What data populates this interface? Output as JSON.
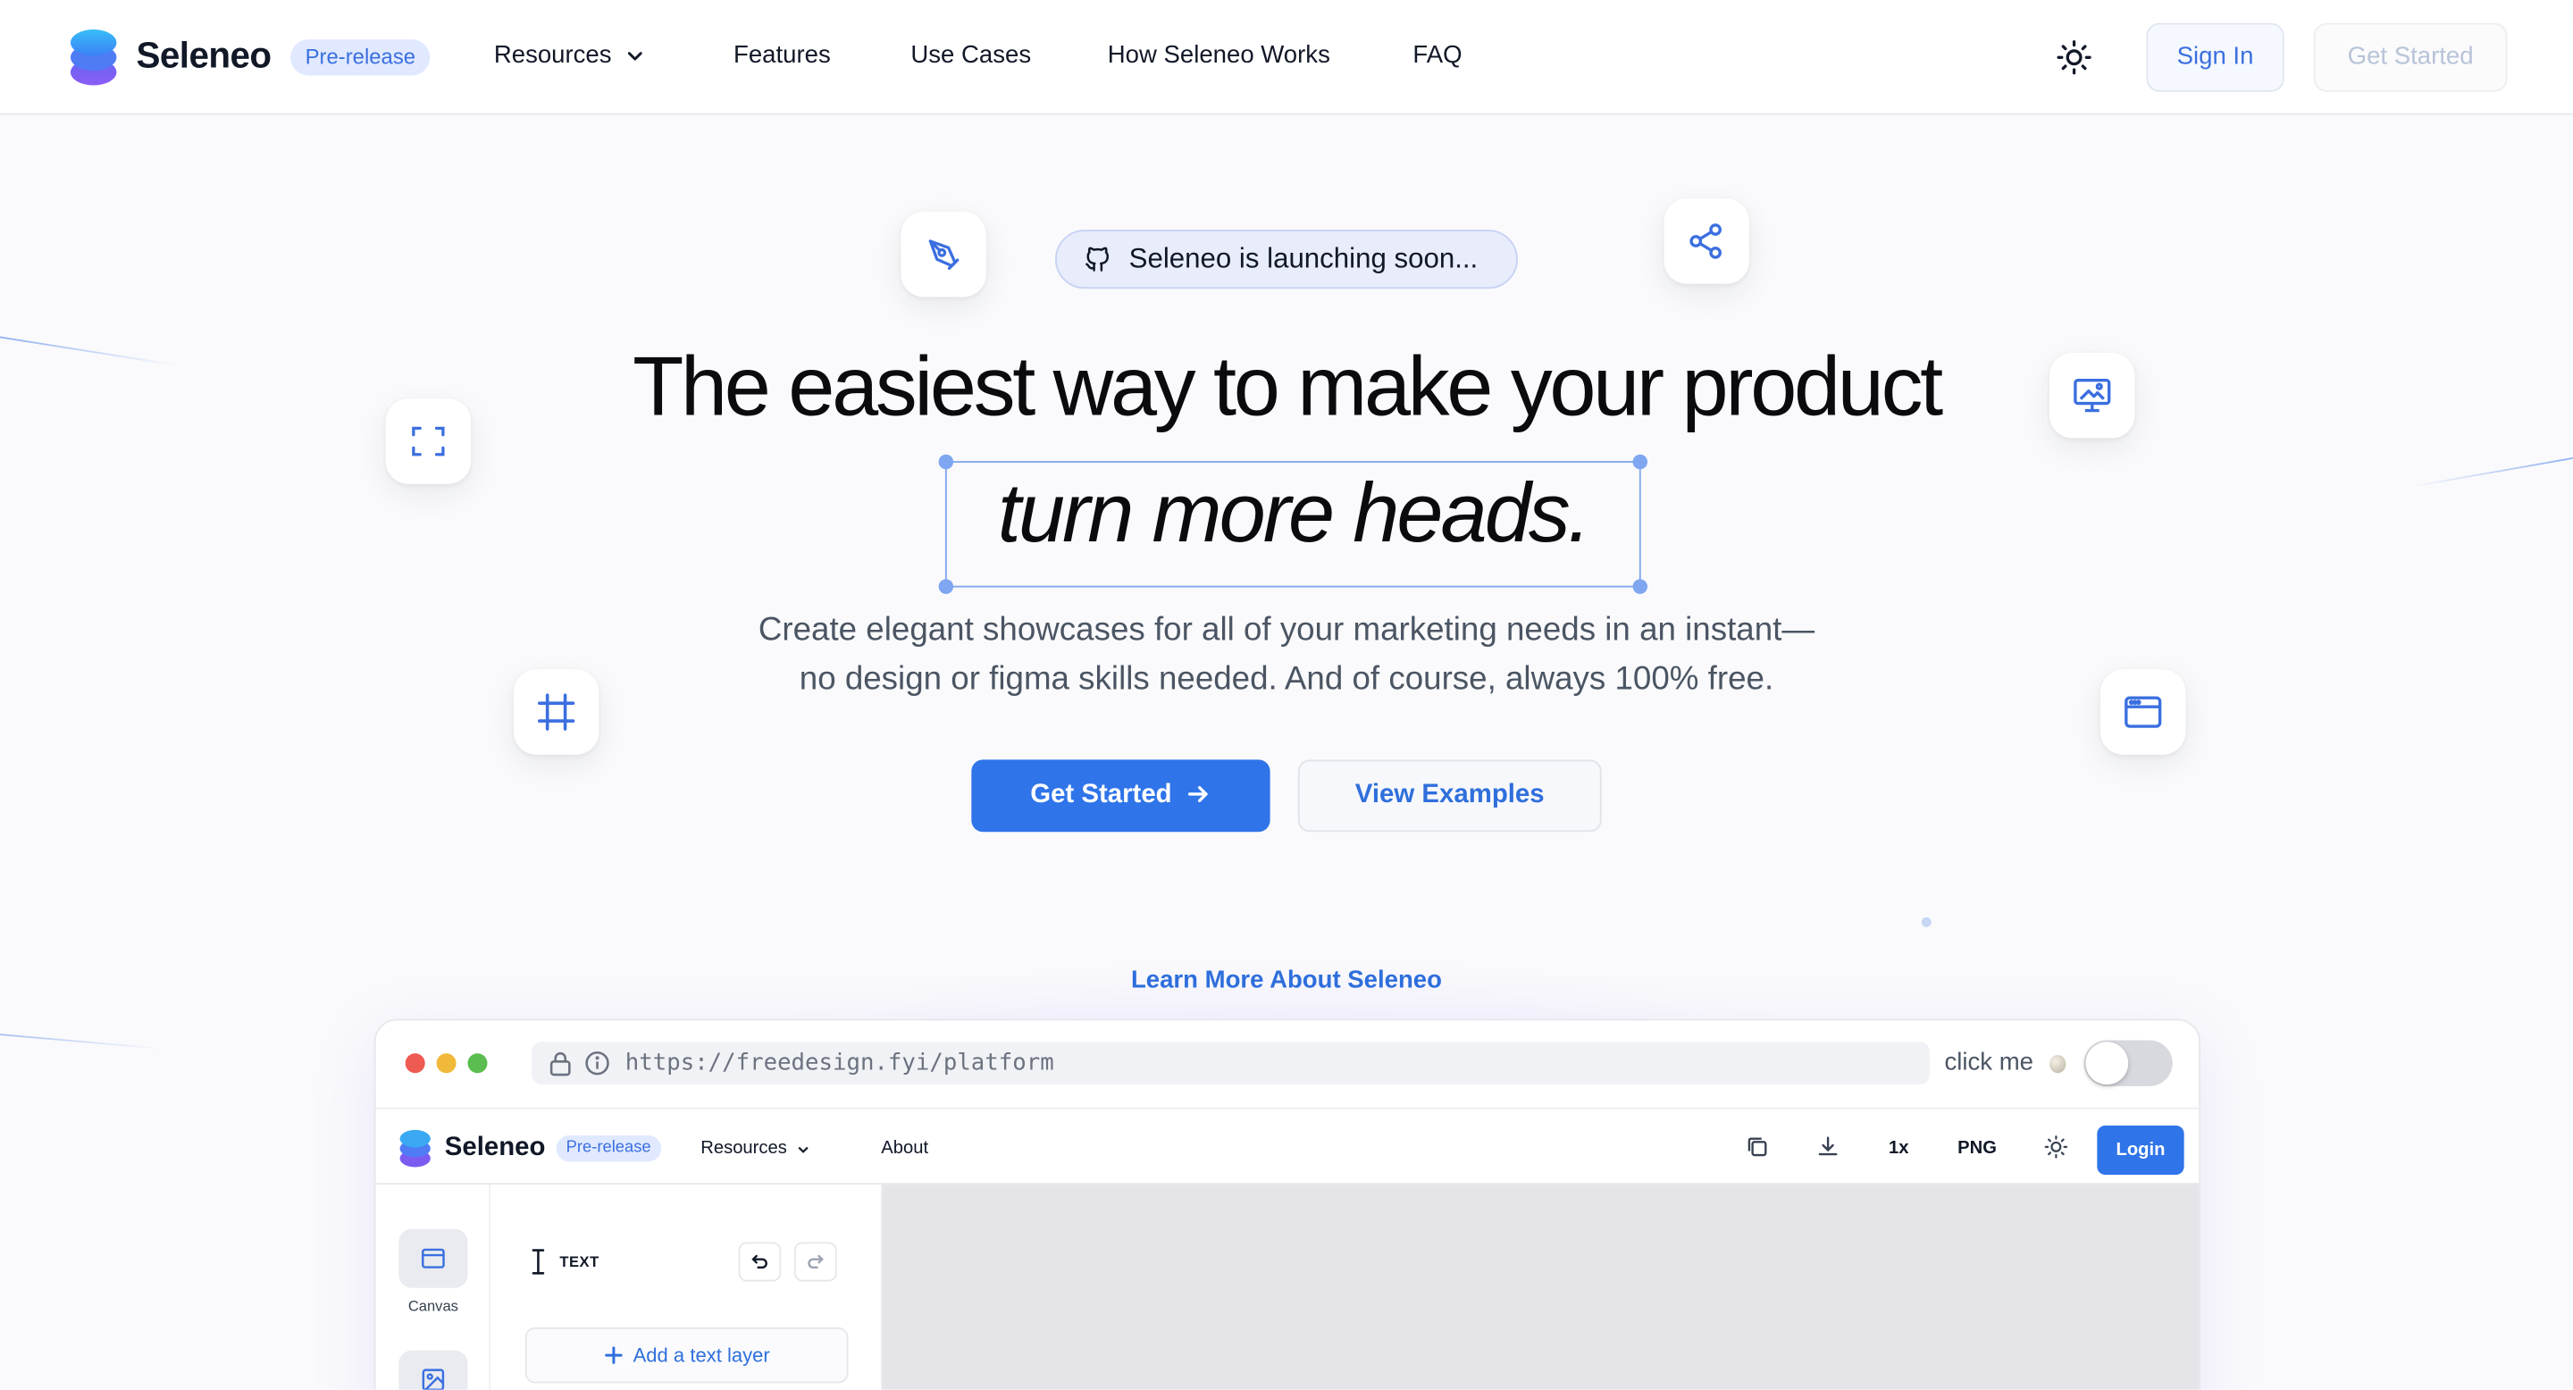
{
  "nav": {
    "brand": "Seleneo",
    "badge": "Pre-release",
    "links": [
      {
        "label": "Resources",
        "has_dropdown": true
      },
      {
        "label": "Features"
      },
      {
        "label": "Use Cases"
      },
      {
        "label": "How Seleneo Works"
      },
      {
        "label": "FAQ"
      }
    ],
    "theme_icon": "sun-icon",
    "sign_in": "Sign In",
    "get_started": "Get Started"
  },
  "hero": {
    "announcement": "Seleneo is launching soon...",
    "headline": "The easiest way to make your product",
    "headline_emphasis": "turn more heads.",
    "subtext_line1": "Create elegant showcases for all of your marketing needs in an instant—",
    "subtext_line2": "no design or figma skills needed. And of course, always 100% free.",
    "cta_primary": "Get Started",
    "cta_secondary": "View Examples",
    "learn_more": "Learn More About Seleneo",
    "floating_icons": [
      "pen-tool-icon",
      "share-icon",
      "focus-frame-icon",
      "image-monitor-icon",
      "hash-frame-icon",
      "browser-window-icon"
    ]
  },
  "preview": {
    "url": "https://freedesign.fyi/platform",
    "toggle_label": "click me",
    "toggle_on": false,
    "app": {
      "brand": "Seleneo",
      "badge": "Pre-release",
      "links": [
        "Resources",
        "About"
      ],
      "scale": "1x",
      "format": "PNG",
      "login": "Login",
      "rail": [
        {
          "label": "Canvas",
          "icon": "browser-window-icon"
        },
        {
          "label": "",
          "icon": "image-icon"
        }
      ],
      "panel_title": "TEXT",
      "add_layer": "Add a text layer"
    }
  },
  "colors": {
    "accent": "#2f74e9",
    "accent_text": "#2f6fdc",
    "badge_bg": "#e0e9ff"
  }
}
